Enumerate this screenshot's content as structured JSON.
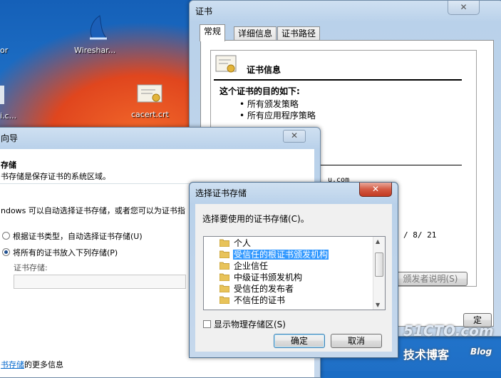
{
  "desktop": {
    "icons": [
      {
        "name": "wireshark",
        "label": "Wireshar..."
      },
      {
        "name": "cacert",
        "label": "cacert.crt"
      }
    ],
    "edge_labels": [
      "or",
      "i.c..."
    ]
  },
  "cert_window": {
    "title": "证书",
    "tabs": [
      "常规",
      "详细信息",
      "证书路径"
    ],
    "heading": "证书信息",
    "purpose_title": "这个证书的目的如下:",
    "purposes": [
      "所有颁发策略",
      "所有应用程序策略"
    ],
    "partial_domain": "u.com",
    "partial_date": "/ 8/ 21",
    "issuer_button": "颁发者说明(S)",
    "bottom_button": "定"
  },
  "wizard_window": {
    "title_fragment": "向导",
    "section_title": "存储",
    "section_desc": "书存储是保存证书的系统区域。",
    "intro": "ndows 可以自动选择证书存储，或者您可以为证书指",
    "options": [
      {
        "label": "根据证书类型，自动选择证书存储(U)",
        "selected": false
      },
      {
        "label": "将所有的证书放入下列存储(P)",
        "selected": true
      }
    ],
    "store_label": "证书存储:",
    "link_text": "书存储",
    "more_info": "的更多信息"
  },
  "dialog": {
    "title": "选择证书存储",
    "prompt": "选择要使用的证书存储(C)。",
    "stores": [
      {
        "label": "个人",
        "selected": false
      },
      {
        "label": "受信任的根证书颁发机构",
        "selected": true
      },
      {
        "label": "企业信任",
        "selected": false
      },
      {
        "label": "中级证书颁发机构",
        "selected": false
      },
      {
        "label": "受信任的发布者",
        "selected": false
      },
      {
        "label": "不信任的证书",
        "selected": false
      }
    ],
    "show_physical": "显示物理存储区(S)",
    "ok": "确定",
    "cancel": "取消"
  },
  "watermark": {
    "site": "51CTO.com",
    "blog_cn": "技术博客",
    "blog_en": "Blog"
  },
  "colors": {
    "selection": "#3399ff",
    "folder": "#e8c35a",
    "close_red": "#c23a22"
  }
}
